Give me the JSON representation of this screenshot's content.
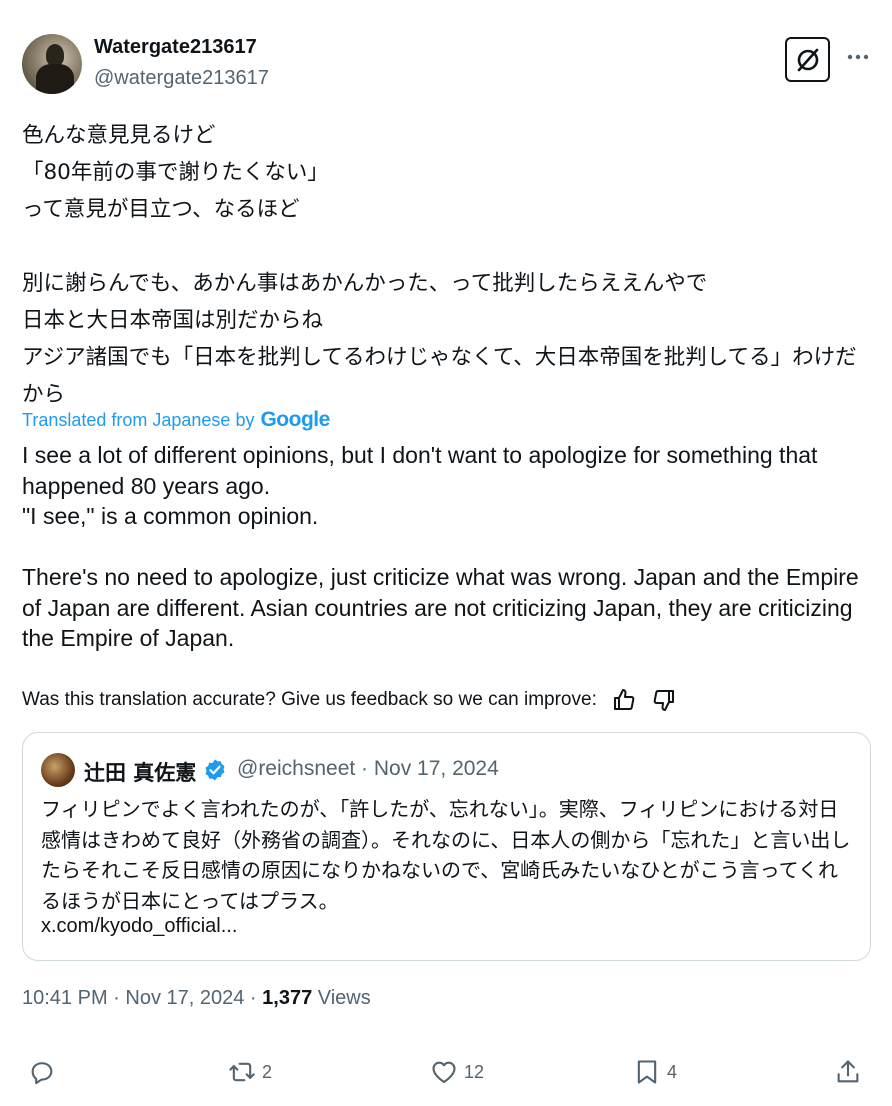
{
  "author": {
    "name": "Watergate213617",
    "handle": "@watergate213617"
  },
  "tweet": {
    "text_ja": "色んな意見見るけど\n「80年前の事で謝りたくない」\nって意見が目立つ、なるほど\n\n別に謝らんでも、あかん事はあかんかった、って批判したらええんやで\n日本と大日本帝国は別だからね\nアジア諸国でも「日本を批判してるわけじゃなくて、大日本帝国を批判してる」わけだから",
    "translated_label": "Translated from Japanese by",
    "translator_brand": "Google",
    "text_en": "I see a lot of different opinions, but I don't want to apologize for something that happened 80 years ago.\n\"I see,\" is a common opinion.\n\nThere's no need to apologize, just criticize what was wrong. Japan and the Empire of Japan are different. Asian countries are not criticizing Japan, they are criticizing the Empire of Japan.",
    "feedback_prompt": "Was this translation accurate? Give us feedback so we can improve:"
  },
  "quote": {
    "name": "辻田 真佐憲",
    "meta": "@reichsneet · Nov 17, 2024",
    "text": "フィリピンでよく言われたのが、「許したが、忘れない」。実際、フィリピンにおける対日感情はきわめて良好（外務省の調査）。それなのに、日本人の側から「忘れた」と言い出したらそれこそ反日感情の原因になりかねないので、宮崎氏みたいなひとがこう言ってくれるほうが日本にとってはプラス。",
    "link": "x.com/kyodo_official..."
  },
  "timestamp": {
    "time_date": "10:41 PM · Nov 17, 2024 · ",
    "views_count": "1,377",
    "views_label": " Views"
  },
  "actions": {
    "reply_count": "",
    "retweet_count": "2",
    "like_count": "12",
    "bookmark_count": "4"
  },
  "colors": {
    "accent": "#1d9bf0",
    "secondary_text": "#536471",
    "border": "#cfd9de"
  }
}
